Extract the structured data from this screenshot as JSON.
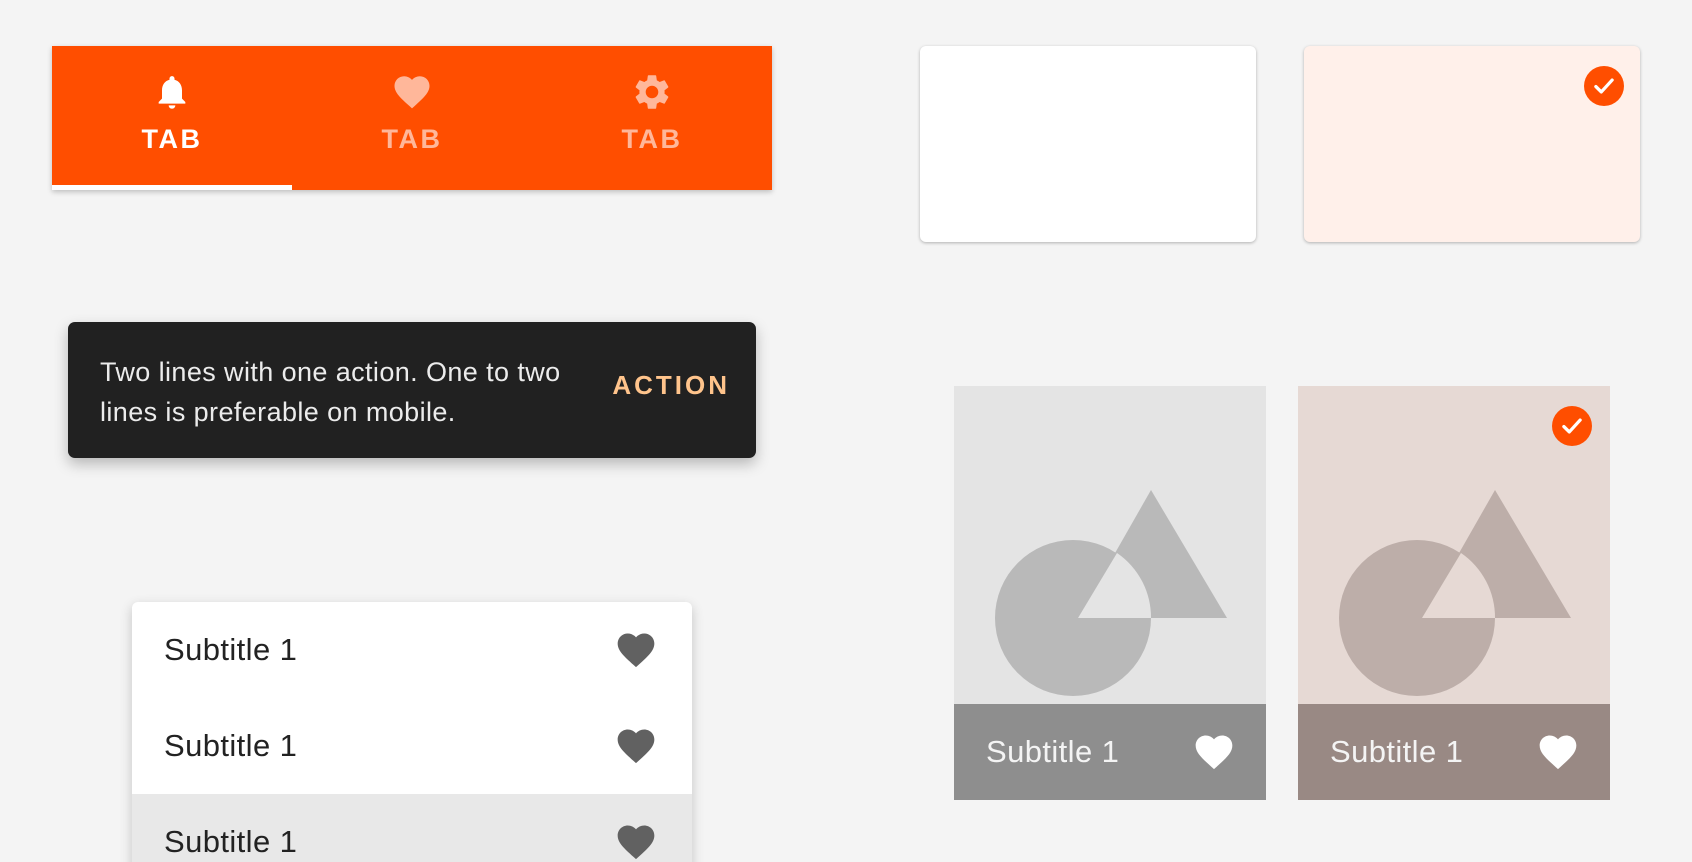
{
  "tabs": {
    "items": [
      {
        "label": "TAB",
        "icon": "bell-icon",
        "active": true
      },
      {
        "label": "TAB",
        "icon": "heart-icon",
        "active": false
      },
      {
        "label": "TAB",
        "icon": "gear-icon",
        "active": false
      }
    ],
    "background_color": "#ff4e00",
    "active_color": "#ffffff",
    "inactive_color": "#ffb79a"
  },
  "selection_cards": [
    {
      "selected": false,
      "background_color": "#ffffff"
    },
    {
      "selected": true,
      "background_color": "#fff0ea",
      "badge_icon": "check-circle-icon"
    }
  ],
  "snackbar": {
    "message": "Two lines with one action. One to two lines is preferable on mobile.",
    "action_label": "ACTION",
    "action_color": "#ffc48c"
  },
  "list": {
    "items": [
      {
        "label": "Subtitle 1",
        "icon": "heart-icon",
        "highlighted": false
      },
      {
        "label": "Subtitle 1",
        "icon": "heart-icon",
        "highlighted": false
      },
      {
        "label": "Subtitle 1",
        "icon": "heart-icon",
        "highlighted": true
      }
    ]
  },
  "image_tiles": [
    {
      "caption": "Subtitle 1",
      "icon": "heart-icon",
      "selected": false,
      "image_icon": "image-placeholder-icon"
    },
    {
      "caption": "Subtitle 1",
      "icon": "heart-icon",
      "selected": true,
      "image_icon": "image-placeholder-icon",
      "badge_icon": "check-circle-icon"
    }
  ],
  "colors": {
    "accent": "#ff4e00",
    "page_background": "#f4f4f4",
    "snackbar_background": "#212121"
  }
}
